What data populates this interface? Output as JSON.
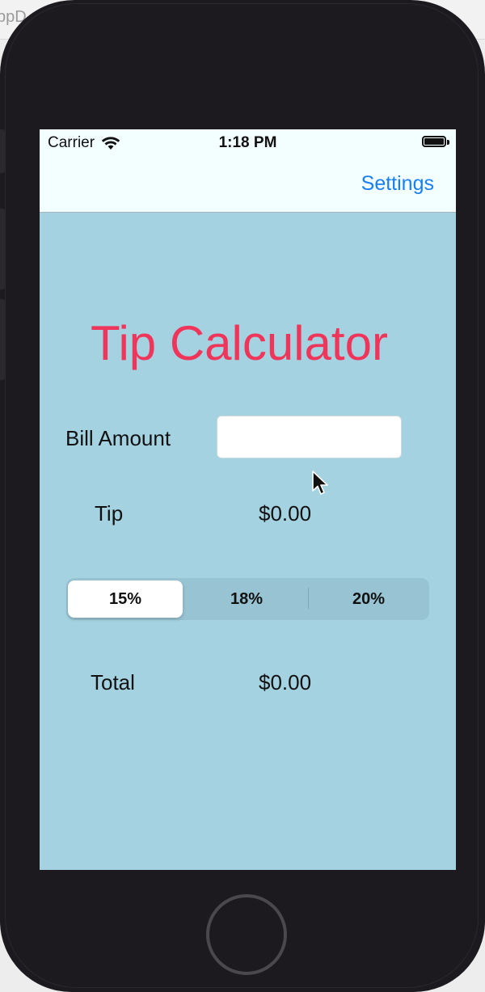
{
  "host": {
    "window_text": "ppD"
  },
  "status_bar": {
    "carrier": "Carrier",
    "time": "1:18 PM"
  },
  "nav": {
    "settings_label": "Settings"
  },
  "main": {
    "title": "Tip Calculator",
    "bill_label": "Bill Amount",
    "bill_value": "",
    "tip_label": "Tip",
    "tip_value": "$0.00",
    "total_label": "Total",
    "total_value": "$0.00",
    "segments": [
      {
        "label": "15%",
        "selected": true
      },
      {
        "label": "18%",
        "selected": false
      },
      {
        "label": "20%",
        "selected": false
      }
    ]
  },
  "colors": {
    "title": "#f0355a",
    "accent": "#1a7ff5",
    "background": "#a4d2e1",
    "navbar": "#f3feff"
  }
}
